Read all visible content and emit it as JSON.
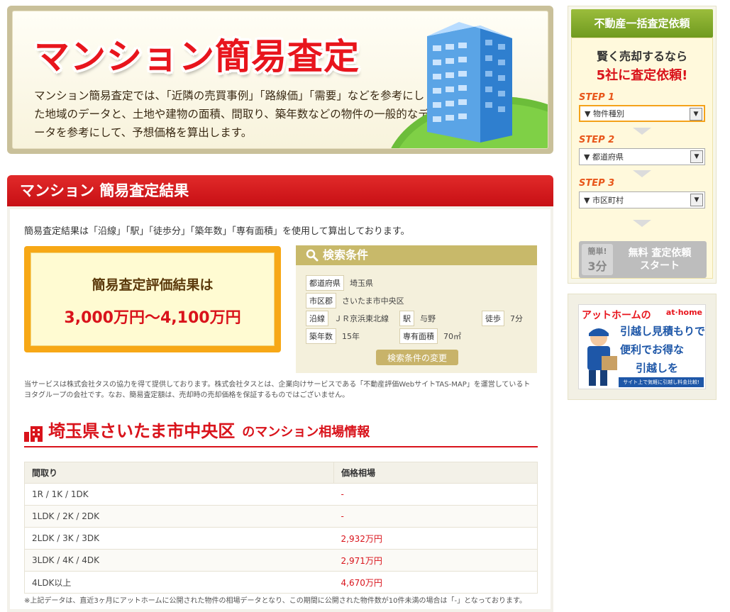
{
  "hero": {
    "title": "マンション簡易査定",
    "desc": "マンション簡易査定では、「近隣の売買事例」「路線価」「需要」などを参考にした地域のデータと、土地や建物の面積、間取り、築年数などの物件の一般的なデータを参考にして、予想価格を算出します。"
  },
  "result": {
    "heading": "マンション 簡易査定結果",
    "intro": "簡易査定結果は「沿線」「駅」「徒歩分」「築年数」「専有面積」を使用して算出しております。",
    "eval_label": "簡易査定評価結果は",
    "eval_value": "3,000万円〜4,100万円"
  },
  "conditions": {
    "title": "検索条件",
    "pref_tag": "都道府県",
    "pref_val": "埼玉県",
    "city_tag": "市区郡",
    "city_val": "さいたま市中央区",
    "line_tag": "沿線",
    "line_val": "ＪＲ京浜東北線",
    "station_tag": "駅",
    "station_val": "与野",
    "walk_tag": "徒歩",
    "walk_val": "7分",
    "age_tag": "築年数",
    "age_val": "15年",
    "area_tag": "専有面積",
    "area_val": "70㎡",
    "change_button": "検索条件の変更"
  },
  "notice": "当サービスは株式会社タスの協力を得て提供しております。株式会社タスとは、企業向けサービスである「不動産評価WebサイトTAS-MAP」を運営しているトヨタグループの会社です。なお、簡易査定額は、売却時の売却価格を保証するものではございません。",
  "area": {
    "name": "埼玉県さいたま市中央区",
    "suffix": "のマンション相場情報",
    "col_layout": "間取り",
    "col_price": "価格相場",
    "rows": [
      {
        "layout": "1R / 1K / 1DK",
        "price": "-"
      },
      {
        "layout": "1LDK / 2K / 2DK",
        "price": "-"
      },
      {
        "layout": "2LDK / 3K / 3DK",
        "price": "2,932万円"
      },
      {
        "layout": "3LDK / 4K / 4DK",
        "price": "2,971万円"
      },
      {
        "layout": "4LDK以上",
        "price": "4,670万円"
      }
    ],
    "footnote": "※上記データは、直近3ヶ月にアットホームに公開された物件の相場データとなり、この期間に公開された物件数が10件未満の場合は「-」となっております。"
  },
  "side": {
    "title": "不動産一括査定依頼",
    "catch1": "賢く売却するなら",
    "catch2": "5社に査定依頼!",
    "step1": "STEP 1",
    "step1_select": "▼ 物件種別",
    "step2": "STEP 2",
    "step2_select": "▼ 都道府県",
    "step3": "STEP 3",
    "step3_select": "▼ 市区町村",
    "badge1": "簡単!",
    "badge2": "3分",
    "start1": "無料 査定依頼",
    "start2": "スタート"
  },
  "banner": {
    "brand_jp": "アットホームの",
    "brand_en": "at·home",
    "line1": "引越し見積もりで",
    "line2": "便利でお得な",
    "line3": "引越しを",
    "foot": "サイト上で気軽に引越し料金比較!"
  },
  "colors": {
    "accent_red": "#d9131b",
    "header_green": "#7fa52a",
    "gold": "#c8b96a",
    "orange": "#f7a816"
  }
}
